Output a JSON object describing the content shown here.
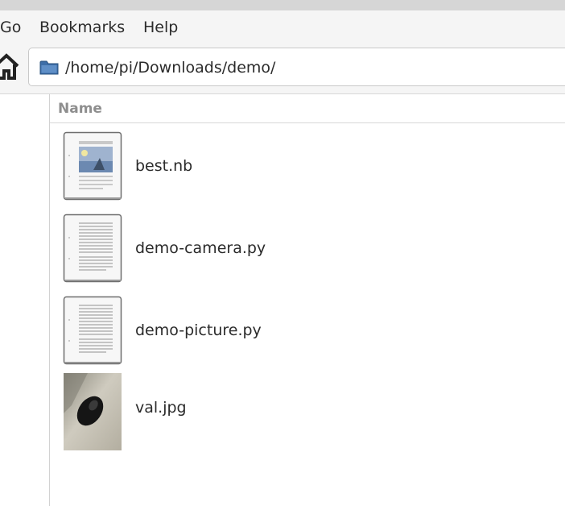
{
  "menubar": {
    "items": [
      "Go",
      "Bookmarks",
      "Help"
    ]
  },
  "toolbar": {
    "home_icon": "home-icon",
    "location": {
      "icon": "folder-icon",
      "path": "/home/pi/Downloads/demo/"
    }
  },
  "file_list": {
    "columns": [
      "Name"
    ],
    "files": [
      {
        "name": "best.nb",
        "icon": "image-document-icon"
      },
      {
        "name": "demo-camera.py",
        "icon": "text-document-icon"
      },
      {
        "name": "demo-picture.py",
        "icon": "text-document-icon"
      },
      {
        "name": "val.jpg",
        "icon": "photo-thumbnail"
      }
    ]
  },
  "colors": {
    "menubar_bg": "#f5f5f5",
    "folder_blue": "#3d6ea8",
    "header_text": "#8e8e8e"
  }
}
